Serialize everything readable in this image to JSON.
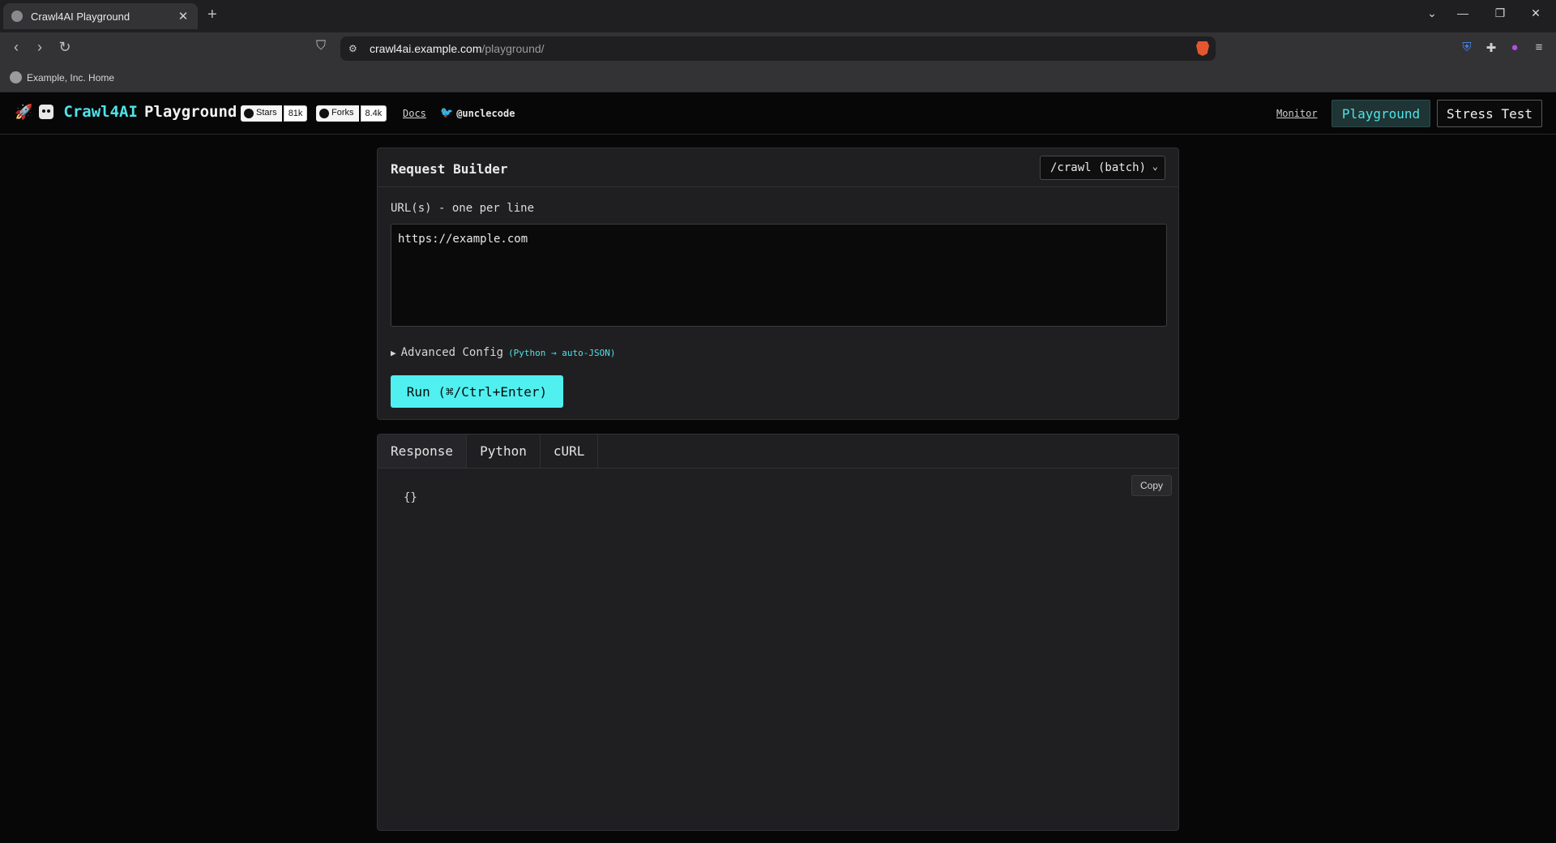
{
  "browser": {
    "tab_title": "Crawl4AI Playground",
    "tab_close": "✕",
    "new_tab": "+",
    "url_host": "crawl4ai.example.com",
    "url_path": "/playground/",
    "bookmark": "Example, Inc. Home"
  },
  "header": {
    "brand_primary": "Crawl4AI",
    "brand_secondary": "Playground",
    "stars_label": "Stars",
    "stars_count": "81k",
    "forks_label": "Forks",
    "forks_count": "8.4k",
    "docs": "Docs",
    "twitter": "@unclecode",
    "nav": {
      "monitor": "Monitor",
      "playground": "Playground",
      "stress": "Stress Test"
    }
  },
  "request": {
    "title": "Request Builder",
    "endpoint": "/crawl (batch)",
    "url_label": "URL(s) - one per line",
    "url_value": "https://example.com",
    "advanced": "Advanced Config",
    "advanced_hint": "(Python → auto-JSON)",
    "run": "Run (⌘/Ctrl+Enter)"
  },
  "response": {
    "tabs": [
      "Response",
      "Python",
      "cURL"
    ],
    "copy": "Copy",
    "output": "{}"
  },
  "colors": {
    "accent": "#4fe3e8",
    "run_button": "#50f0f0",
    "background": "#070708",
    "panel": "#1f1f21"
  }
}
